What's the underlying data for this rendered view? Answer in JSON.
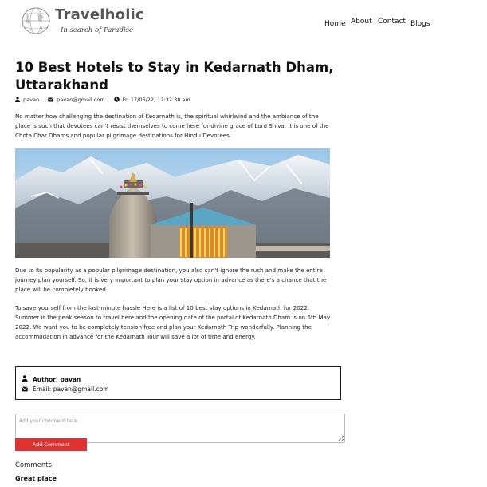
{
  "header": {
    "logo_title": "Travelholic",
    "logo_tagline": "In search of Paradise",
    "nav": [
      "Home",
      "About",
      "Contact",
      "Blogs"
    ]
  },
  "post": {
    "title": "10 Best Hotels to Stay in Kedarnath Dham, Uttarakhand",
    "meta": {
      "author": "pavan",
      "email": "pavan@gmail.com",
      "date": "Fr, 17/06/22, 12:32:38 am"
    },
    "paragraphs": [
      "No matter how challenging the destination of Kedarnath is, the spiritual whirlwind and the ambiance of the place is such that devotees can't resist themselves to come here for divine grace of Lord Shiva. It is one of the Chota Char Dhams and popular pilgrimage destinations for Hindu Devotees.",
      "Due to its popularity as a popular pilgrimage destination, you also can't ignore the rush and make the entire journey plan yourself. So, it is very important to plan your stay option in advance as there's a chance that the place will be completely booked.",
      "To save yourself from the last-minute hassle Here is a list of 10 best stay options in Kedarnath for 2022. Summer is the peak season to travel here and the opening date of the portal of Kedarnath Dham is on 6th May 2022. We want you to be completely tension free and plan your Kedarnath Trip wonderfully. Planning the accommodation in advance for the Kedarnath Tour will save a lot of time and energy."
    ]
  },
  "author_box": {
    "name_line": "Author: pavan",
    "email_line": "Email: pavan@gmail.com"
  },
  "comment_form": {
    "placeholder": "Add your comment here",
    "button_label": "Add Comment"
  },
  "comments": {
    "heading": "Comments",
    "items": [
      {
        "text": "Great place"
      }
    ]
  },
  "colors": {
    "accent_red": "#e03131",
    "text_dark": "#111111"
  }
}
